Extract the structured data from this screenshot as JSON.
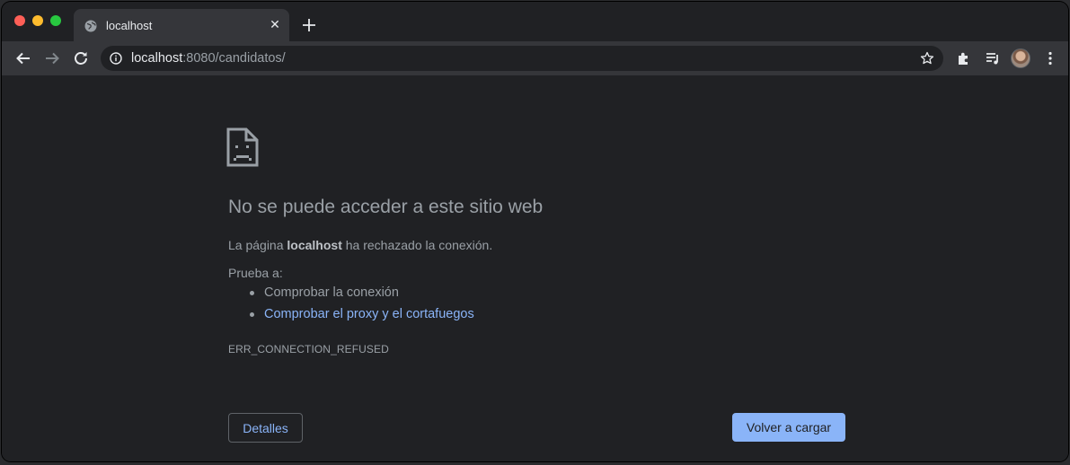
{
  "tab": {
    "title": "localhost",
    "favicon": "globe-icon",
    "close_icon": "close-icon",
    "close_glyph": "✕"
  },
  "toolbar": {
    "back_icon": "back-arrow-icon",
    "forward_icon": "forward-arrow-icon",
    "reload_icon": "reload-icon",
    "new_tab_icon": "plus-icon",
    "extensions_icon": "puzzle-icon",
    "media_icon": "media-queue-icon",
    "menu_icon": "kebab-menu-icon"
  },
  "omnibox": {
    "host": "localhost",
    "rest": ":8080/candidatos/",
    "info_icon": "info-icon",
    "bookmark_icon": "star-icon"
  },
  "error_page": {
    "icon": "sad-document-icon",
    "heading": "No se puede acceder a este sitio web",
    "message_prefix": "La página ",
    "message_host": "localhost",
    "message_suffix": " ha rechazado la conexión.",
    "try_label": "Prueba a:",
    "suggestions": [
      {
        "text": "Comprobar la conexión",
        "is_link": false
      },
      {
        "text": "Comprobar el proxy y el cortafuegos",
        "is_link": true
      }
    ],
    "error_code": "ERR_CONNECTION_REFUSED",
    "details_button": "Detalles",
    "reload_button": "Volver a cargar"
  },
  "colors": {
    "frame": "#202124",
    "toolbar": "#35363a",
    "text_secondary": "#9aa0a6",
    "link": "#8ab4f8",
    "primary_button": "#8ab4f8"
  }
}
